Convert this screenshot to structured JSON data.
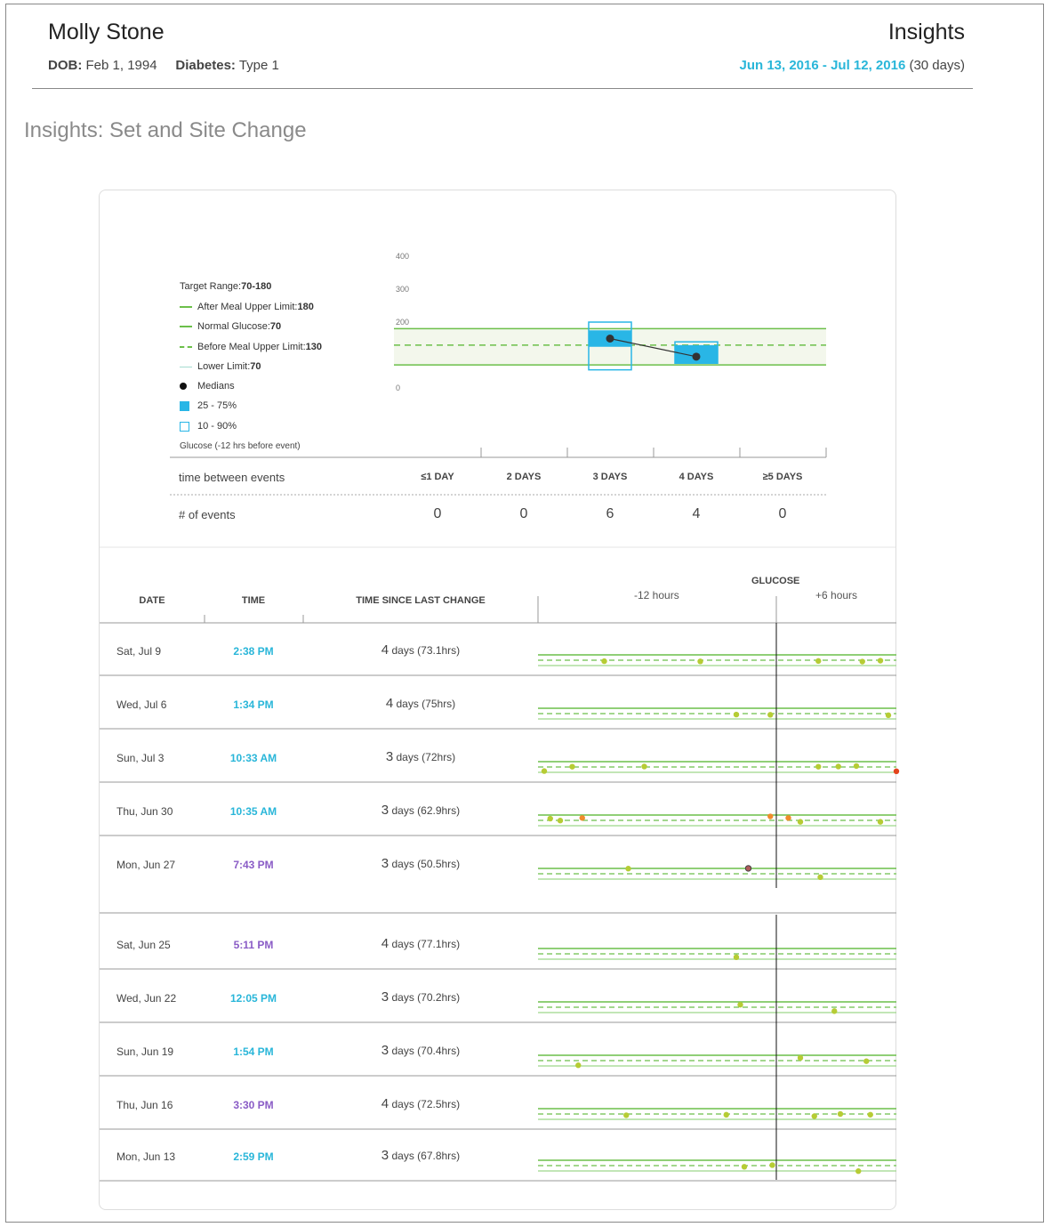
{
  "header": {
    "patient_name": "Molly Stone",
    "page_title": "Insights",
    "dob_label": "DOB:",
    "dob_value": "Feb 1, 1994",
    "diabetes_label": "Diabetes:",
    "diabetes_value": "Type 1",
    "range_start": "Jun 13, 2016",
    "range_sep": " - ",
    "range_end": "Jul 12, 2016",
    "range_days": " (30 days)"
  },
  "section_title": "Insights: Set and Site Change",
  "legend": {
    "target_label": "Target Range: ",
    "target_value": "70-180",
    "after_meal_label": "After Meal Upper Limit:",
    "after_meal_value": "180",
    "normal_label": "Normal Glucose:",
    "normal_value": "70",
    "before_meal_label": "Before Meal Upper Limit:",
    "before_meal_value": "130",
    "lower_label": "Lower Limit:",
    "lower_value": "70",
    "medians_label": "Medians",
    "iqr_label": "25 - 75%",
    "decile_label": "10 - 90%",
    "footer": "Glucose (-12 hrs before event)"
  },
  "colors": {
    "accent_cyan": "#29b6d9",
    "purple": "#8a5cc6",
    "green_line": "#6cbf4a",
    "dot_green": "#b6cc34",
    "dot_orange": "#f08c2c",
    "dot_red": "#e3441c",
    "box_blue": "#29b6e6"
  },
  "summary": {
    "time_between_label": "time between events",
    "events_label": "# of events",
    "buckets": [
      "≤1 DAY",
      "2 DAYS",
      "3 DAYS",
      "4 DAYS",
      "≥5 DAYS"
    ],
    "counts": [
      "0",
      "0",
      "6",
      "4",
      "0"
    ]
  },
  "table": {
    "col_date": "DATE",
    "col_time": "TIME",
    "col_since": "TIME SINCE LAST CHANGE",
    "col_glucose": "GLUCOSE",
    "minus12": "-12 hours",
    "plus6": "+6 hours",
    "rows": [
      {
        "date": "Sat, Jul 9",
        "time": "2:38 PM",
        "time_color": "#29b6d9",
        "num": "4",
        "since": " days (73.1hrs)"
      },
      {
        "date": "Wed, Jul 6",
        "time": "1:34 PM",
        "time_color": "#29b6d9",
        "num": "4",
        "since": " days (75hrs)"
      },
      {
        "date": "Sun, Jul 3",
        "time": "10:33 AM",
        "time_color": "#29b6d9",
        "num": "3",
        "since": " days (72hrs)"
      },
      {
        "date": "Thu, Jun 30",
        "time": "10:35 AM",
        "time_color": "#29b6d9",
        "num": "3",
        "since": " days (62.9hrs)"
      },
      {
        "date": "Mon, Jun 27",
        "time": "7:43 PM",
        "time_color": "#8a5cc6",
        "num": "3",
        "since": " days (50.5hrs)"
      },
      {
        "date": "Sat, Jun 25",
        "time": "5:11 PM",
        "time_color": "#8a5cc6",
        "num": "4",
        "since": " days (77.1hrs)"
      },
      {
        "date": "Wed, Jun 22",
        "time": "12:05 PM",
        "time_color": "#29b6d9",
        "num": "3",
        "since": " days (70.2hrs)"
      },
      {
        "date": "Sun, Jun 19",
        "time": "1:54 PM",
        "time_color": "#29b6d9",
        "num": "3",
        "since": " days (70.4hrs)"
      },
      {
        "date": "Thu, Jun 16",
        "time": "3:30 PM",
        "time_color": "#8a5cc6",
        "num": "4",
        "since": " days (72.5hrs)"
      },
      {
        "date": "Mon, Jun 13",
        "time": "2:59 PM",
        "time_color": "#29b6d9",
        "num": "3",
        "since": " days (67.8hrs)"
      }
    ]
  },
  "chart_data": {
    "type": "box",
    "title": "",
    "ylabel": "Glucose (-12 hrs before event)",
    "ylim": [
      0,
      400
    ],
    "yticks": [
      0,
      100,
      200,
      300,
      400
    ],
    "target_range": [
      70,
      180
    ],
    "before_meal_upper": 130,
    "categories": [
      "≤1 DAY",
      "2 DAYS",
      "3 DAYS",
      "4 DAYS",
      "≥5 DAYS"
    ],
    "boxes": [
      {
        "category": "3 DAYS",
        "p10": 55,
        "p25": 125,
        "median": 150,
        "p75": 175,
        "p90": 200
      },
      {
        "category": "4 DAYS",
        "p10": 75,
        "p25": 75,
        "median": 95,
        "p75": 130,
        "p90": 140
      }
    ]
  },
  "glucose_strips": {
    "xlim_hours": [
      -12,
      6
    ],
    "rows": [
      {
        "points": [
          [
            -8.6,
            115,
            "g"
          ],
          [
            -3.8,
            113,
            "g"
          ],
          [
            2.1,
            117,
            "g"
          ],
          [
            4.3,
            111,
            "g"
          ],
          [
            5.2,
            120,
            "g"
          ]
        ]
      },
      {
        "points": [
          [
            -2.0,
            115,
            "g"
          ],
          [
            -0.3,
            113,
            "g"
          ],
          [
            5.6,
            108,
            "g"
          ]
        ]
      },
      {
        "points": [
          [
            -11.6,
            83,
            "g"
          ],
          [
            -10.2,
            128,
            "g"
          ],
          [
            -6.6,
            130,
            "g"
          ],
          [
            2.1,
            128,
            "g"
          ],
          [
            3.1,
            130,
            "g"
          ],
          [
            4.0,
            135,
            "g"
          ],
          [
            6.0,
            81,
            "r"
          ]
        ]
      },
      {
        "points": [
          [
            -11.3,
            143,
            "g"
          ],
          [
            -10.8,
            123,
            "g"
          ],
          [
            -9.7,
            150,
            "o"
          ],
          [
            -0.3,
            166,
            "o"
          ],
          [
            0.6,
            150,
            "o"
          ],
          [
            1.2,
            110,
            "g"
          ],
          [
            5.2,
            110,
            "g"
          ]
        ]
      },
      {
        "points": [
          [
            -7.4,
            178,
            "g"
          ],
          [
            -1.4,
            181,
            "dark"
          ],
          [
            2.2,
            90,
            "g"
          ]
        ]
      },
      {
        "points": [
          [
            -2.0,
            90,
            "g"
          ]
        ]
      },
      {
        "points": [
          [
            -1.8,
            151,
            "g"
          ],
          [
            2.9,
            85,
            "g"
          ]
        ]
      },
      {
        "points": [
          [
            1.2,
            153,
            "g"
          ],
          [
            -9.9,
            77,
            "g"
          ],
          [
            4.5,
            119,
            "g"
          ]
        ]
      },
      {
        "points": [
          [
            -7.5,
            112,
            "g"
          ],
          [
            -2.5,
            117,
            "g"
          ],
          [
            1.9,
            102,
            "g"
          ],
          [
            3.2,
            125,
            "g"
          ],
          [
            4.7,
            118,
            "g"
          ]
        ]
      },
      {
        "points": [
          [
            -1.6,
            113,
            "g"
          ],
          [
            -0.2,
            130,
            "g"
          ],
          [
            4.1,
            68,
            "g"
          ]
        ]
      }
    ]
  }
}
